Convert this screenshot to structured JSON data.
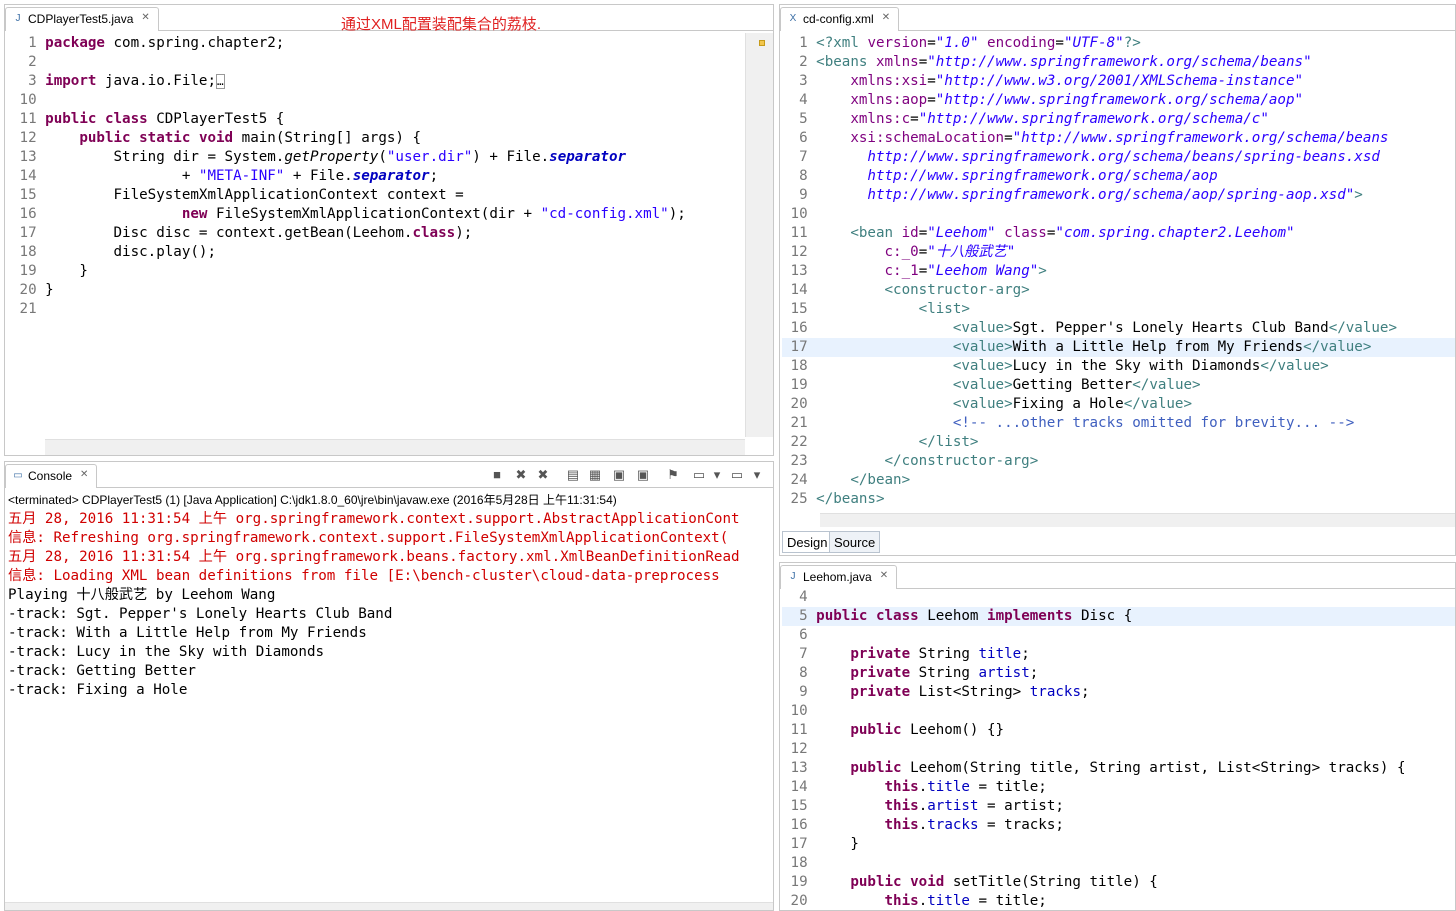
{
  "editor1": {
    "tab_label": "CDPlayerTest5.java",
    "annotation": "通过XML配置装配集合的荔枝.",
    "lines": [
      {
        "n": "1",
        "html": "<span class=\"kw\">package</span> com.spring.chapter2;"
      },
      {
        "n": "2",
        "html": ""
      },
      {
        "n": "3",
        "html": "<span class=\"kw\">import</span> java.io.File;<span style=\"border:1px solid #999;font-size:11px\">…</span>"
      },
      {
        "n": "10",
        "html": ""
      },
      {
        "n": "11",
        "html": "<span class=\"kw\">public</span> <span class=\"kw\">class</span> CDPlayerTest5 {"
      },
      {
        "n": "12",
        "html": "    <span class=\"kw\">public</span> <span class=\"kw\">static</span> <span class=\"kw\">void</span> main(String[] args) {"
      },
      {
        "n": "13",
        "html": "        String dir = System.<span class=\"ital\">getProperty</span>(<span class=\"str\">\"user.dir\"</span>) + File.<span class=\"sfld\">separator</span>"
      },
      {
        "n": "14",
        "html": "                + <span class=\"str\">\"META-INF\"</span> + File.<span class=\"sfld\">separator</span>;"
      },
      {
        "n": "15",
        "html": "        FileSystemXmlApplicationContext context ="
      },
      {
        "n": "16",
        "html": "                <span class=\"kw\">new</span> FileSystemXmlApplicationContext(dir + <span class=\"str\">\"cd-config.xml\"</span>);"
      },
      {
        "n": "17",
        "html": "        Disc disc = context.getBean(Leehom.<span class=\"kw\">class</span>);"
      },
      {
        "n": "18",
        "html": "        disc.play();"
      },
      {
        "n": "19",
        "html": "    }"
      },
      {
        "n": "20",
        "html": "}"
      },
      {
        "n": "21",
        "html": ""
      }
    ]
  },
  "console": {
    "tab_label": "Console",
    "status": "<terminated> CDPlayerTest5 (1) [Java Application] C:\\jdk1.8.0_60\\jre\\bin\\javaw.exe (2016年5月28日 上午11:31:54)",
    "lines": [
      {
        "cls": "err",
        "text": "五月 28, 2016 11:31:54 上午 org.springframework.context.support.AbstractApplicationCont"
      },
      {
        "cls": "err",
        "text": "信息: Refreshing org.springframework.context.support.FileSystemXmlApplicationContext("
      },
      {
        "cls": "err",
        "text": "五月 28, 2016 11:31:54 上午 org.springframework.beans.factory.xml.XmlBeanDefinitionRead"
      },
      {
        "cls": "err",
        "text": "信息: Loading XML bean definitions from file [E:\\bench-cluster\\cloud-data-preprocess"
      },
      {
        "cls": "",
        "text": "Playing 十八般武艺 by Leehom Wang"
      },
      {
        "cls": "",
        "text": "-track: Sgt. Pepper's Lonely Hearts Club Band"
      },
      {
        "cls": "",
        "text": "-track: With a Little Help from My Friends"
      },
      {
        "cls": "",
        "text": "-track: Lucy in the Sky with Diamonds"
      },
      {
        "cls": "",
        "text": "-track: Getting Better"
      },
      {
        "cls": "",
        "text": "-track: Fixing a Hole"
      }
    ]
  },
  "editor2": {
    "tab_label": "cd-config.xml",
    "design_tab": "Design",
    "source_tab": "Source",
    "lines": [
      {
        "n": "1",
        "html": "<span class=\"xtag\">&lt;?xml</span> <span class=\"xattr\">version</span>=<span class=\"xval\">\"1.0\"</span> <span class=\"xattr\">encoding</span>=<span class=\"xval\">\"UTF-8\"</span><span class=\"xtag\">?&gt;</span>"
      },
      {
        "n": "2",
        "html": "<span class=\"xtag\">&lt;beans</span> <span class=\"xattr\">xmlns</span>=<span class=\"xval\">\"http://www.springframework.org/schema/beans\"</span>"
      },
      {
        "n": "3",
        "html": "    <span class=\"xattr\">xmlns:xsi</span>=<span class=\"xval\">\"http://www.w3.org/2001/XMLSchema-instance\"</span>"
      },
      {
        "n": "4",
        "html": "    <span class=\"xattr\">xmlns:aop</span>=<span class=\"xval\">\"http://www.springframework.org/schema/aop\"</span>"
      },
      {
        "n": "5",
        "html": "    <span class=\"xattr\">xmlns:c</span>=<span class=\"xval\">\"http://www.springframework.org/schema/c\"</span>"
      },
      {
        "n": "6",
        "html": "    <span class=\"xattr\">xsi:schemaLocation</span>=<span class=\"xval\">\"http://www.springframework.org/schema/beans</span>"
      },
      {
        "n": "7",
        "html": "      <span class=\"xval\">http://www.springframework.org/schema/beans/spring-beans.xsd</span>"
      },
      {
        "n": "8",
        "html": "      <span class=\"xval\">http://www.springframework.org/schema/aop</span>"
      },
      {
        "n": "9",
        "html": "      <span class=\"xval\">http://www.springframework.org/schema/aop/spring-aop.xsd\"</span><span class=\"xtag\">&gt;</span>"
      },
      {
        "n": "10",
        "html": ""
      },
      {
        "n": "11",
        "html": "    <span class=\"xtag\">&lt;bean</span> <span class=\"xattr\">id</span>=<span class=\"xval\">\"Leehom\"</span> <span class=\"xattr\">class</span>=<span class=\"xval\">\"com.spring.chapter2.Leehom\"</span>"
      },
      {
        "n": "12",
        "html": "        <span class=\"xattr\">c:_0</span>=<span class=\"xval\">\"十八般武艺\"</span>"
      },
      {
        "n": "13",
        "html": "        <span class=\"xattr\">c:_1</span>=<span class=\"xval\">\"Leehom Wang\"</span><span class=\"xtag\">&gt;</span>"
      },
      {
        "n": "14",
        "html": "        <span class=\"xtag\">&lt;constructor-arg&gt;</span>"
      },
      {
        "n": "15",
        "html": "            <span class=\"xtag\">&lt;list&gt;</span>"
      },
      {
        "n": "16",
        "html": "                <span class=\"xtag\">&lt;value&gt;</span>Sgt. Pepper's Lonely Hearts Club Band<span class=\"xtag\">&lt;/value&gt;</span>"
      },
      {
        "n": "17",
        "html": "                <span class=\"xtag\">&lt;value&gt;</span>With a Little Help from My Friends<span class=\"xtag\">&lt;/value&gt;</span>",
        "hl": true
      },
      {
        "n": "18",
        "html": "                <span class=\"xtag\">&lt;value&gt;</span>Lucy in the Sky with Diamonds<span class=\"xtag\">&lt;/value&gt;</span>"
      },
      {
        "n": "19",
        "html": "                <span class=\"xtag\">&lt;value&gt;</span>Getting Better<span class=\"xtag\">&lt;/value&gt;</span>"
      },
      {
        "n": "20",
        "html": "                <span class=\"xtag\">&lt;value&gt;</span>Fixing a Hole<span class=\"xtag\">&lt;/value&gt;</span>"
      },
      {
        "n": "21",
        "html": "                <span class=\"xcom\">&lt;!-- ...other tracks omitted for brevity... --&gt;</span>"
      },
      {
        "n": "22",
        "html": "            <span class=\"xtag\">&lt;/list&gt;</span>"
      },
      {
        "n": "23",
        "html": "        <span class=\"xtag\">&lt;/constructor-arg&gt;</span>"
      },
      {
        "n": "24",
        "html": "    <span class=\"xtag\">&lt;/bean&gt;</span>"
      },
      {
        "n": "25",
        "html": "<span class=\"xtag\">&lt;/beans&gt;</span>"
      }
    ]
  },
  "editor3": {
    "tab_label": "Leehom.java",
    "lines": [
      {
        "n": "4",
        "html": ""
      },
      {
        "n": "5",
        "html": "<span class=\"kw\">public</span> <span class=\"kw\">class</span> Leehom <span class=\"kw\">implements</span> Disc {",
        "hl": true
      },
      {
        "n": "6",
        "html": ""
      },
      {
        "n": "7",
        "html": "    <span class=\"kw\">private</span> String <span class=\"fld\">title</span>;"
      },
      {
        "n": "8",
        "html": "    <span class=\"kw\">private</span> String <span class=\"fld\">artist</span>;"
      },
      {
        "n": "9",
        "html": "    <span class=\"kw\">private</span> List&lt;String&gt; <span class=\"fld\">tracks</span>;"
      },
      {
        "n": "10",
        "html": ""
      },
      {
        "n": "11",
        "html": "    <span class=\"kw\">public</span> Leehom() {}"
      },
      {
        "n": "12",
        "html": ""
      },
      {
        "n": "13",
        "html": "    <span class=\"kw\">public</span> Leehom(String title, String artist, List&lt;String&gt; tracks) {"
      },
      {
        "n": "14",
        "html": "        <span class=\"kw\">this</span>.<span class=\"fld\">title</span> = title;"
      },
      {
        "n": "15",
        "html": "        <span class=\"kw\">this</span>.<span class=\"fld\">artist</span> = artist;"
      },
      {
        "n": "16",
        "html": "        <span class=\"kw\">this</span>.<span class=\"fld\">tracks</span> = tracks;"
      },
      {
        "n": "17",
        "html": "    }"
      },
      {
        "n": "18",
        "html": ""
      },
      {
        "n": "19",
        "html": "    <span class=\"kw\">public</span> <span class=\"kw\">void</span> setTitle(String title) {"
      },
      {
        "n": "20",
        "html": "        <span class=\"kw\">this</span>.<span class=\"fld\">title</span> = title;"
      }
    ]
  }
}
